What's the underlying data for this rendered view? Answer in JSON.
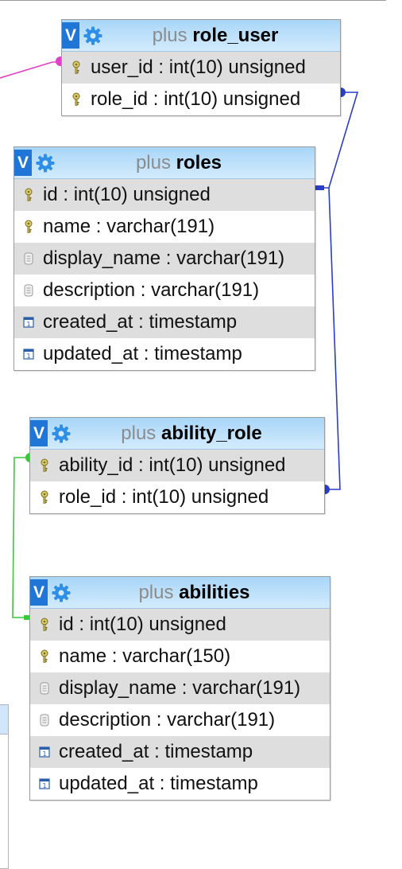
{
  "colors": {
    "header_top": "#a8d6f8",
    "header_bottom": "#d3ebfd",
    "v_button": "#1f76d6",
    "row_alt": "#dedede",
    "link_role_user_users": "#e040c8",
    "link_roles": "#2a3ec8",
    "link_abilities": "#3ac83a",
    "key_icon": "#b8a848"
  },
  "tables": [
    {
      "db": "plus",
      "name": "role_user",
      "columns": [
        {
          "name": "user_id",
          "sep": " : ",
          "type": "int(10) unsigned",
          "icon": "key-icon"
        },
        {
          "name": "role_id",
          "sep": " : ",
          "type": "int(10) unsigned",
          "icon": "key-icon"
        }
      ]
    },
    {
      "db": "plus",
      "name": "roles",
      "columns": [
        {
          "name": "id",
          "sep": " : ",
          "type": "int(10) unsigned",
          "icon": "key-icon"
        },
        {
          "name": "name",
          "sep": " : ",
          "type": "varchar(191)",
          "icon": "key-icon"
        },
        {
          "name": "display_name",
          "sep": " : ",
          "type": "varchar(191)",
          "icon": "text-icon"
        },
        {
          "name": "description",
          "sep": " : ",
          "type": "varchar(191)",
          "icon": "text-icon"
        },
        {
          "name": "created_at",
          "sep": " : ",
          "type": "timestamp",
          "icon": "timestamp-icon"
        },
        {
          "name": "updated_at",
          "sep": " : ",
          "type": "timestamp",
          "icon": "timestamp-icon"
        }
      ]
    },
    {
      "db": "plus",
      "name": "ability_role",
      "columns": [
        {
          "name": "ability_id",
          "sep": " : ",
          "type": "int(10) unsigned",
          "icon": "key-icon"
        },
        {
          "name": "role_id",
          "sep": " : ",
          "type": "int(10) unsigned",
          "icon": "key-icon"
        }
      ]
    },
    {
      "db": "plus",
      "name": "abilities",
      "columns": [
        {
          "name": "id",
          "sep": " : ",
          "type": "int(10) unsigned",
          "icon": "key-icon"
        },
        {
          "name": "name",
          "sep": " : ",
          "type": "varchar(150)",
          "icon": "key-icon"
        },
        {
          "name": "display_name",
          "sep": " : ",
          "type": "varchar(191)",
          "icon": "text-icon"
        },
        {
          "name": "description",
          "sep": " : ",
          "type": "varchar(191)",
          "icon": "text-icon"
        },
        {
          "name": "created_at",
          "sep": " : ",
          "type": "timestamp",
          "icon": "timestamp-icon"
        },
        {
          "name": "updated_at",
          "sep": " : ",
          "type": "timestamp",
          "icon": "timestamp-icon"
        }
      ]
    }
  ],
  "header_icons": {
    "toggle_label": "V",
    "options_icon": "gear-icon"
  }
}
